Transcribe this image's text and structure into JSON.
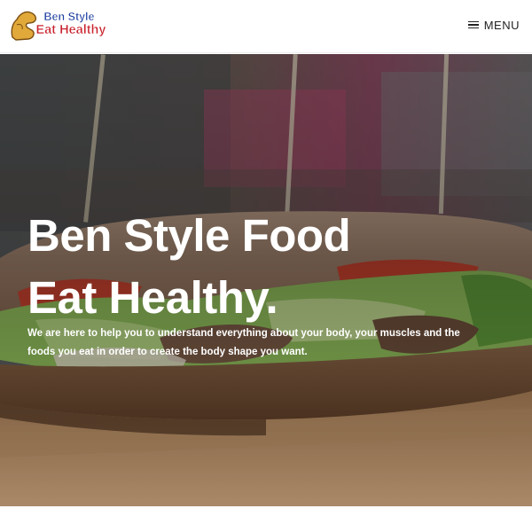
{
  "header": {
    "logo": {
      "line1": "Ben Style",
      "line2": "Eat Healthy"
    },
    "menu_label": "MENU"
  },
  "hero": {
    "title_line1": "Ben Style Food",
    "title_line2": "Eat Healthy.",
    "description": "We are here to help you to understand everything about your body, your muscles and the foods you eat in order to create the body shape you want."
  },
  "colors": {
    "logo_blue": "#1d3fa0",
    "logo_red": "#c8202a",
    "logo_gold": "#e0a93a",
    "hero_text": "#ffffff"
  },
  "icons": {
    "menu": "hamburger-icon",
    "logo": "flexing-arm-icon"
  }
}
